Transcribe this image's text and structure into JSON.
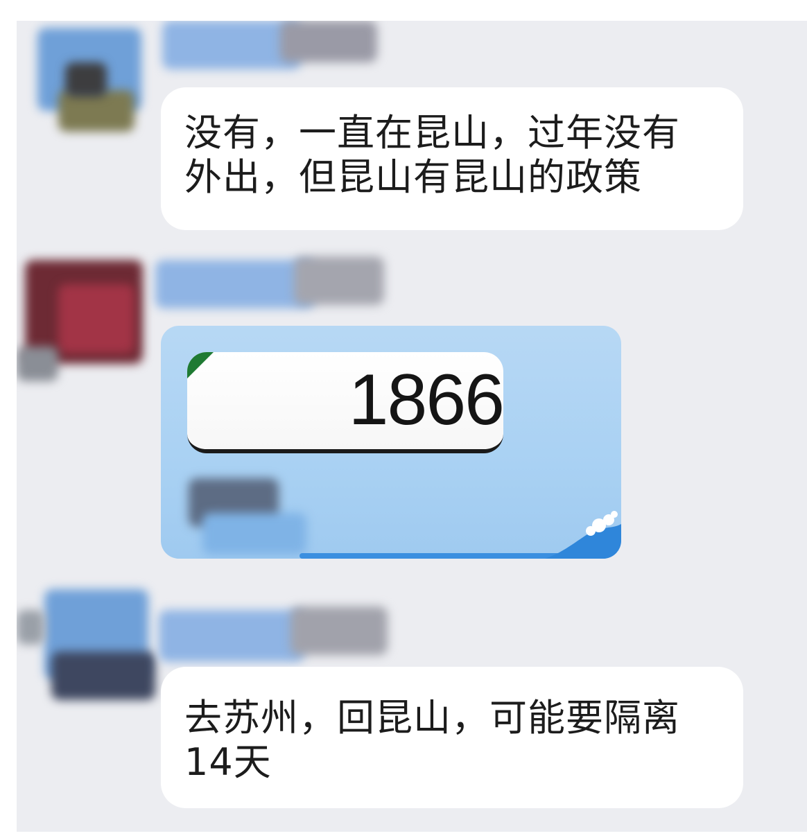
{
  "conversation": {
    "messages": [
      {
        "lines": [
          "没有，一直在昆山，过年没有",
          "外出，但昆山有昆山的政策"
        ]
      },
      {
        "image_amount": "1866"
      },
      {
        "lines": [
          "去苏州，回昆山，可能要隔离",
          "14天"
        ]
      }
    ]
  },
  "colors": {
    "chat_background": "#ecedf1",
    "bubble": "#ffffff",
    "image_card": "#aed3f3",
    "text": "#1c1c1c"
  },
  "icons": [
    "avatar-blurred",
    "wave-icon"
  ]
}
